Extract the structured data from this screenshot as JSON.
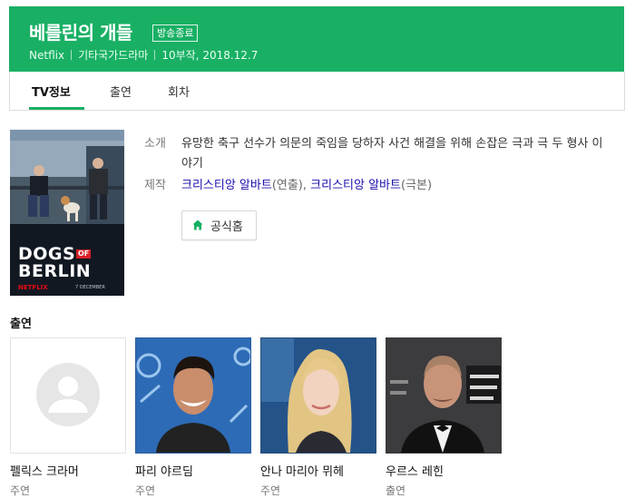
{
  "header": {
    "title": "베를린의 개들",
    "status_badge": "방송종료",
    "network": "Netflix",
    "genre": "기타국가드라마",
    "episodes_date": "10부작, 2018.12.7"
  },
  "tabs": [
    {
      "label": "TV정보",
      "active": true
    },
    {
      "label": "출연",
      "active": false
    },
    {
      "label": "회차",
      "active": false
    }
  ],
  "poster": {
    "logo_line1": "DOGS",
    "logo_of": "OF",
    "logo_line2": "BERLIN",
    "brand": "NETFLIX",
    "date": "7 DECEMBER"
  },
  "info": {
    "synopsis_label": "소개",
    "synopsis": "유망한 축구 선수가 의문의 죽임을 당하자 사건 해결을 위해 손잡은 극과 극 두 형사 이야기",
    "production_label": "제작",
    "director_name": "크리스티앙 알바트",
    "director_role": "(연출), ",
    "writer_name": "크리스티앙 알바트",
    "writer_role": "(극본)",
    "homepage_button": "공식홈"
  },
  "cast_section_title": "출연",
  "cast": [
    {
      "name": "펠릭스 크라머",
      "role": "주연"
    },
    {
      "name": "파리 야르딤",
      "role": "주연"
    },
    {
      "name": "안나 마리아 뮈헤",
      "role": "주연"
    },
    {
      "name": "우르스 레힌",
      "role": "출연"
    }
  ],
  "colors": {
    "accent": "#19b064",
    "link": "#1a0dab"
  }
}
